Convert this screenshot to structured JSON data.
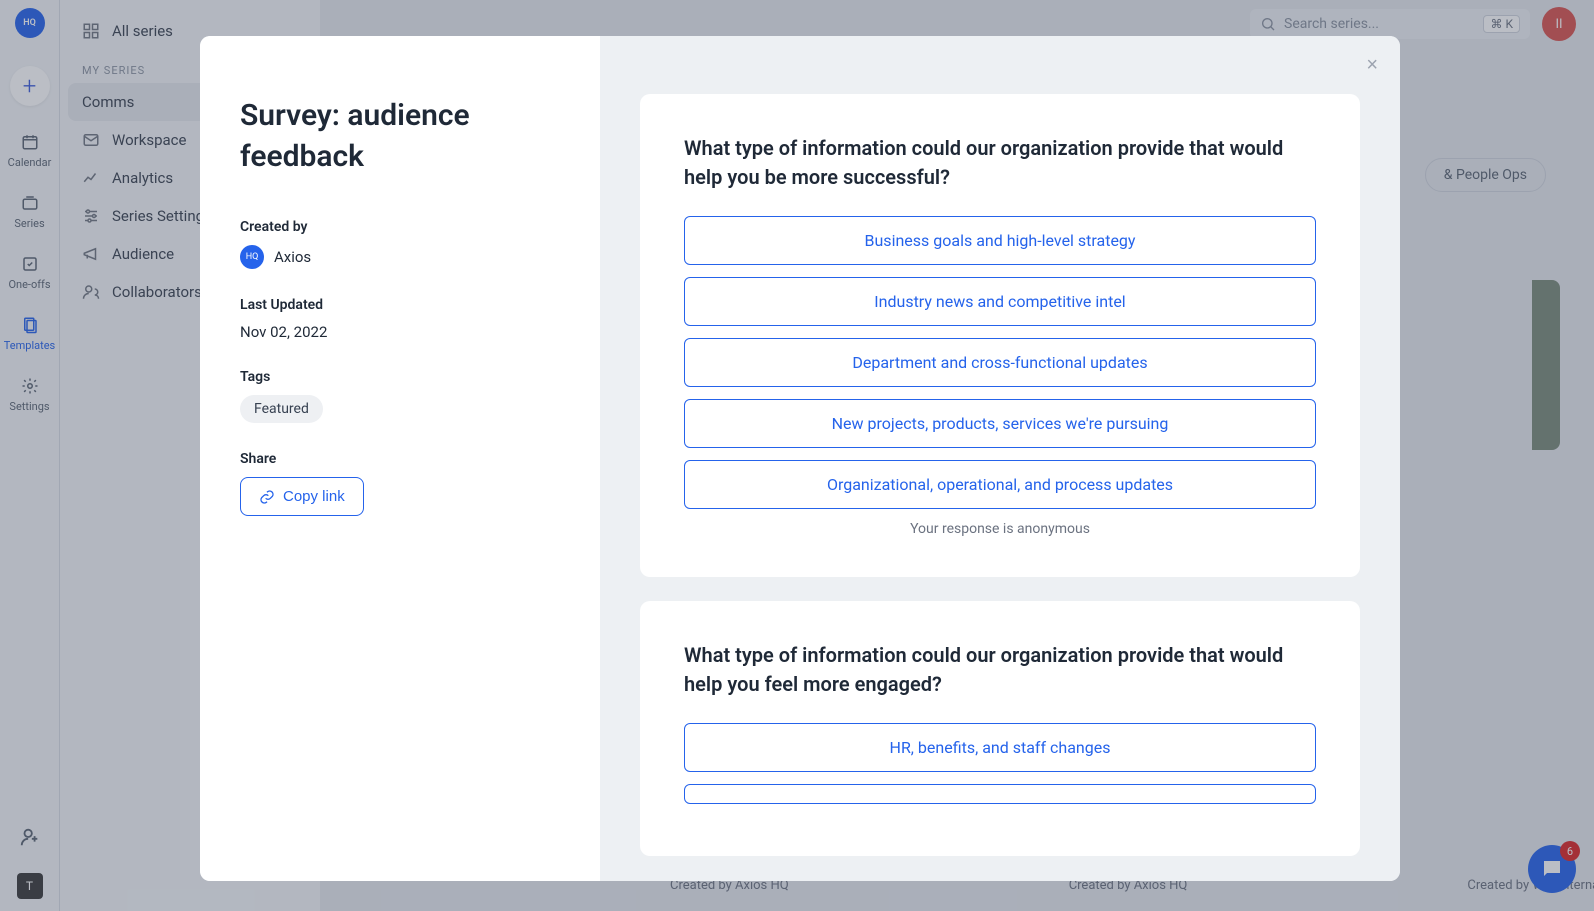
{
  "brand": {
    "logo": "HQ"
  },
  "rail": {
    "calendar": "Calendar",
    "series": "Series",
    "oneoffs": "One-offs",
    "templates": "Templates",
    "settings": "Settings",
    "user_initial": "T"
  },
  "sidebar": {
    "all_series": "All series",
    "header": "MY SERIES",
    "items": [
      {
        "label": "Comms"
      },
      {
        "label": "Workspace"
      },
      {
        "label": "Analytics"
      },
      {
        "label": "Series Settings"
      },
      {
        "label": "Audience"
      },
      {
        "label": "Collaborators"
      }
    ]
  },
  "topbar": {
    "search_placeholder": "Search series...",
    "shortcut": "⌘ K",
    "user_initial": "II"
  },
  "background": {
    "pill": "& People Ops",
    "credits": [
      "Created by Axios HQ",
      "Created by Axios HQ",
      "Created by WW International"
    ],
    "chat_badge": "6"
  },
  "modal": {
    "title": "Survey: audience feedback",
    "created_by_label": "Created by",
    "creator_badge": "HQ",
    "creator_name": "Axios",
    "last_updated_label": "Last Updated",
    "last_updated_value": "Nov 02, 2022",
    "tags_label": "Tags",
    "tag_1": "Featured",
    "share_label": "Share",
    "copy_link": "Copy link",
    "close": "×",
    "survey": {
      "q1": "What type of information could our organization provide that would help you be more successful?",
      "q1_opts": [
        "Business goals and high-level strategy",
        "Industry news and competitive intel",
        "Department and cross-functional updates",
        "New projects, products, services we're pursuing",
        "Organizational, operational, and  process updates"
      ],
      "anon_note": "Your response is anonymous",
      "q2": "What type of information could our organization provide that would help you feel more engaged?",
      "q2_opts": [
        "HR, benefits, and staff changes"
      ]
    }
  }
}
